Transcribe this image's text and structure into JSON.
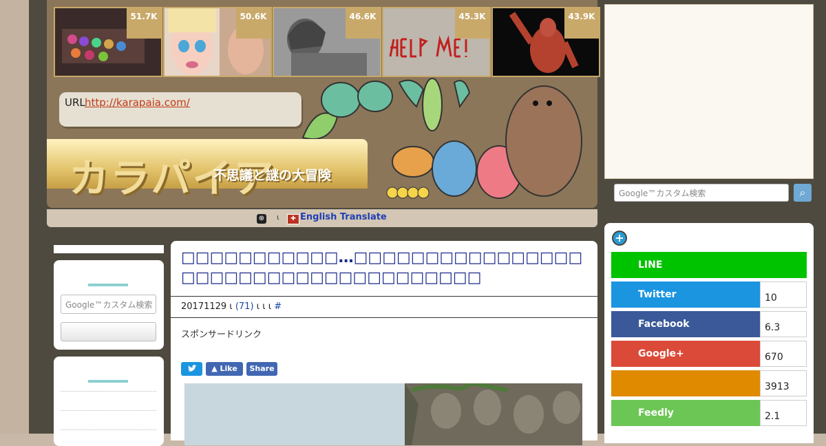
{
  "thumbs": [
    {
      "count": "51.7K",
      "topic": "eyeshadow-palette"
    },
    {
      "count": "50.6K",
      "topic": "doll-faces"
    },
    {
      "count": "46.6K",
      "topic": "spartan-statue"
    },
    {
      "count": "45.3K",
      "topic": "help-me-wall"
    },
    {
      "count": "43.9K",
      "topic": "anatomy-muscles"
    }
  ],
  "header": {
    "url_label": "URL",
    "url_link": "http://karapaia.com/",
    "logo": "カラパイア",
    "tagline": "不思議と謎の大冒険"
  },
  "translate": {
    "separator": "ι",
    "label": "English Translate"
  },
  "search": {
    "placeholder": "Google™カスタム検索"
  },
  "article": {
    "title": "□□□□□□□□□□□…□□□□□□□□□□□□□□□□□□□□□□□□□□□□□□□□□□□□□",
    "meta_date": "20171129 ι",
    "meta_comments": "(71)",
    "meta_tail": "ι ι ι",
    "meta_hash": "#",
    "sponsor": "スポンサードリンク",
    "like_label": "Like",
    "share_label": "Share"
  },
  "share": [
    {
      "name": "LINE",
      "count": "",
      "color": "#00c300"
    },
    {
      "name": "Twitter",
      "count": "10",
      "color": "#1b95e0"
    },
    {
      "name": "Facebook",
      "count": "6.3",
      "color": "#3b5998"
    },
    {
      "name": "Google+",
      "count": "670",
      "color": "#db4a39"
    },
    {
      "name": "",
      "count": "3913",
      "color": "#e08a00"
    },
    {
      "name": "Feedly",
      "count": "2.1",
      "color": "#6cc655"
    }
  ],
  "colors": {
    "header_bg": "#8b7659",
    "page_bg": "#4e4a3f",
    "gold": "#c9a96a",
    "title_blue": "#1a2a8a"
  }
}
